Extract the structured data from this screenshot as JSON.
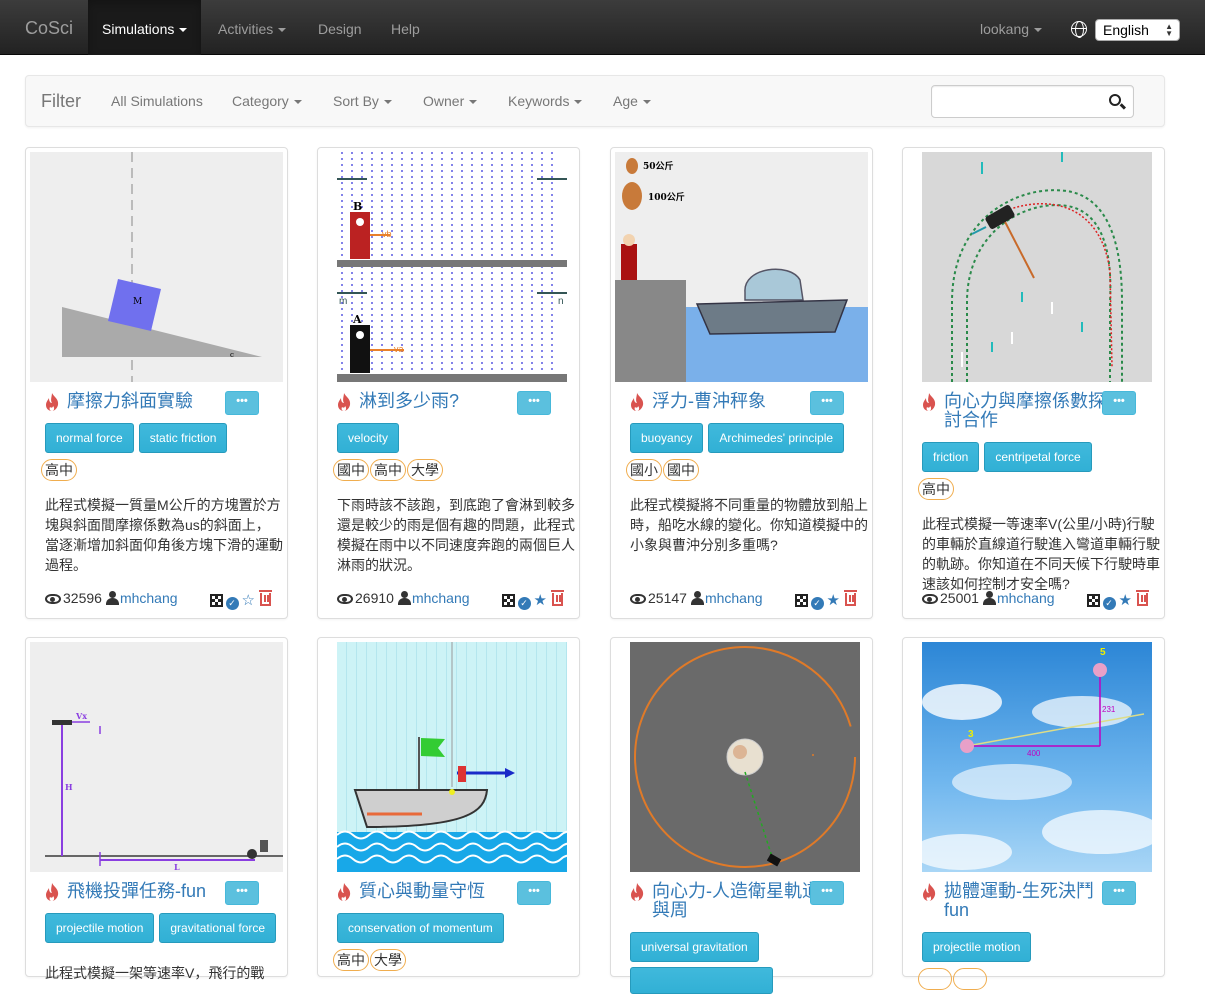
{
  "nav": {
    "brand": "CoSci",
    "items": [
      "Simulations",
      "Activities",
      "Design",
      "Help"
    ],
    "user": "lookang",
    "language": "English"
  },
  "filter": {
    "title": "Filter",
    "items": [
      "All Simulations",
      "Category",
      "Sort By",
      "Owner",
      "Keywords",
      "Age"
    ],
    "search_placeholder": ""
  },
  "cards": [
    {
      "title": "摩擦力斜面實驗",
      "tags": [
        "normal force",
        "static friction"
      ],
      "levels": [
        "高中"
      ],
      "desc": "此程式模擬一質量M公斤的方塊置於方塊與斜面間摩擦係數為us的斜面上，當逐漸增加斜面仰角後方塊下滑的運動過程。",
      "views": "32596",
      "owner": "mhchang",
      "starred": false
    },
    {
      "title": "淋到多少雨?",
      "tags": [
        "velocity"
      ],
      "levels": [
        "國中",
        "高中",
        "大學"
      ],
      "desc": "下雨時該不該跑，到底跑了會淋到較多還是較少的雨是個有趣的問題，此程式模擬在雨中以不同速度奔跑的兩個巨人淋雨的狀況。",
      "views": "26910",
      "owner": "mhchang",
      "starred": true
    },
    {
      "title": "浮力-曹沖秤象",
      "tags": [
        "buoyancy",
        "Archimedes' principle"
      ],
      "levels": [
        "國小",
        "國中"
      ],
      "desc": "此程式模擬將不同重量的物體放到船上時，船吃水線的變化。你知道模擬中的小象與曹沖分別多重嗎?",
      "views": "25147",
      "owner": "mhchang",
      "starred": true
    },
    {
      "title": "向心力與摩擦係數探討合作",
      "tags": [
        "friction",
        "centripetal force"
      ],
      "levels": [
        "高中"
      ],
      "desc": "此程式模擬一等速率V(公里/小時)行駛的車輛於直線道行駛進入彎道車輛行駛的軌跡。你知道在不同天候下行駛時車速該如何控制才安全嗎?",
      "views": "25001",
      "owner": "mhchang",
      "starred": true
    },
    {
      "title": "飛機投彈任務-fun",
      "tags": [
        "projectile motion",
        "gravitational force"
      ],
      "levels": [],
      "desc": "此程式模擬一架等速率V，飛行的戰",
      "views": "",
      "owner": "",
      "starred": false
    },
    {
      "title": "質心與動量守恆",
      "tags": [
        "conservation of momentum"
      ],
      "levels": [
        "高中",
        "大學"
      ],
      "desc": "",
      "views": "",
      "owner": "",
      "starred": false
    },
    {
      "title": "向心力-人造衛星軌道與周",
      "tags": [
        "universal gravitation",
        ""
      ],
      "levels": [],
      "desc": "",
      "views": "",
      "owner": "",
      "starred": false
    },
    {
      "title": "拋體運動-生死決鬥fun",
      "tags": [
        "projectile motion"
      ],
      "levels": [
        "",
        ""
      ],
      "desc": "",
      "views": "",
      "owner": "",
      "starred": false
    }
  ],
  "thumb_labels": {
    "incline_block": "M",
    "incline_c": "c",
    "rain_B": "B",
    "rain_A": "A",
    "rain_vb": "vb",
    "rain_va": "va",
    "rain_m": "m",
    "rain_n": "n",
    "boat_50": "50公斤",
    "boat_100": "100公斤",
    "plane_vx": "Vx",
    "plane_H": "H",
    "plane_L": "L",
    "duel_5": "5",
    "duel_3": "3",
    "duel_231": "231",
    "duel_400": "400"
  },
  "colors": {
    "navbar": "#222222",
    "link": "#337ab7",
    "tag": "#31b0d5",
    "level_border": "#f0ad4e",
    "fire": "#d9534f"
  }
}
